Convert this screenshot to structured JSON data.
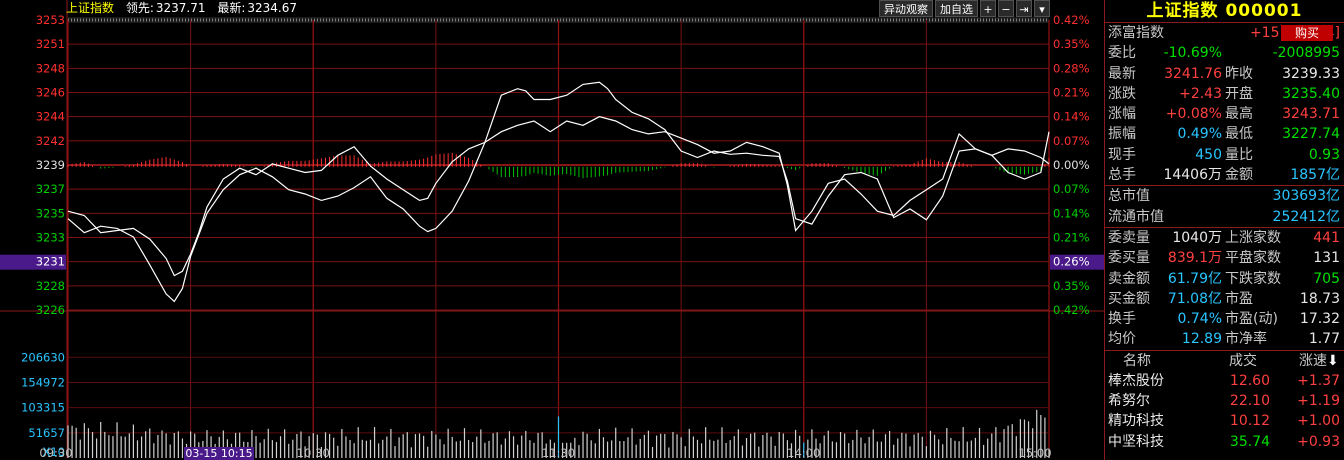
{
  "header": {
    "title": "上证指数",
    "lead_label": "领先:",
    "lead_value": "3237.71",
    "latest_label": "最新:",
    "latest_value": "3234.67"
  },
  "toolbar": {
    "watch_label": "异动观察",
    "add_label": "加自选",
    "plus_symbol": "+",
    "minus_symbol": "−",
    "next_symbol": "⇥",
    "menu_symbol": "▾"
  },
  "price_axis": {
    "left_labels": [
      "3253",
      "3251",
      "3248",
      "3246",
      "3244",
      "3242",
      "3239",
      "3237",
      "3235",
      "3233",
      "3231",
      "3228",
      "3226"
    ],
    "right_labels": [
      "0.42%",
      "0.35%",
      "0.28%",
      "0.21%",
      "0.14%",
      "0.07%",
      "0.00%",
      "0.07%",
      "0.14%",
      "0.21%",
      "0.26%",
      "0.35%",
      "0.42%"
    ],
    "highlight_label": "3231",
    "highlight_right": "0.26%"
  },
  "volume_axis": {
    "labels": [
      "206630",
      "154972",
      "103315",
      "51657"
    ],
    "unit": "X10"
  },
  "time_axis": {
    "labels": [
      "09:30",
      "10:30",
      "11:30",
      "14:00",
      "15:00"
    ],
    "cursor_label": "03-15 10:15"
  },
  "chart_data": {
    "type": "line",
    "title": "上证指数",
    "prev_close": 3239.33,
    "ylim": [
      3226,
      3253
    ],
    "x_ticks": [
      "09:30",
      "10:30",
      "11:30",
      "14:00",
      "15:00"
    ],
    "volume_ylim": [
      0,
      258288
    ],
    "series": [
      {
        "name": "最新",
        "color": "#ffffff",
        "x": [
          0,
          4,
          8,
          12,
          16,
          20,
          24,
          26,
          28,
          30,
          32,
          34,
          38,
          42,
          46,
          50,
          54,
          58,
          62,
          66,
          70,
          74,
          78,
          82,
          86,
          88,
          90,
          94,
          98,
          102,
          106,
          110,
          112,
          114,
          118,
          122,
          126,
          130,
          132,
          134,
          138,
          142,
          146,
          150,
          154,
          158,
          162,
          166,
          170,
          174,
          176,
          178,
          182,
          186,
          190,
          194,
          198,
          202,
          206,
          210,
          214,
          218,
          222,
          226,
          230,
          234,
          238,
          240
        ],
        "values": [
          3234.5,
          3233.2,
          3233.8,
          3233.6,
          3232.8,
          3230.2,
          3227.5,
          3226.8,
          3228,
          3231,
          3233,
          3235,
          3237.2,
          3238.6,
          3239.2,
          3238.4,
          3237.2,
          3236.8,
          3236.2,
          3236.6,
          3237.4,
          3238.4,
          3236.4,
          3235.4,
          3233.8,
          3233.3,
          3233.6,
          3235.2,
          3238,
          3241.6,
          3246,
          3246.6,
          3246.4,
          3245.6,
          3245.6,
          3246,
          3247,
          3247.2,
          3246.6,
          3245.6,
          3244.4,
          3243.8,
          3242.8,
          3240.8,
          3240.2,
          3240.8,
          3240.5,
          3240.6,
          3240.4,
          3240.3,
          3238,
          3234.5,
          3234,
          3236.6,
          3238.6,
          3238.8,
          3238.2,
          3234.6,
          3235.4,
          3234.4,
          3236.6,
          3240.8,
          3241,
          3240.4,
          3241,
          3240.8,
          3240.2,
          3239.6
        ]
      },
      {
        "name": "领先",
        "color": "#ffffff",
        "x": [
          0,
          4,
          8,
          12,
          16,
          20,
          24,
          26,
          28,
          30,
          32,
          34,
          38,
          42,
          46,
          50,
          54,
          58,
          62,
          66,
          70,
          74,
          78,
          82,
          86,
          88,
          90,
          94,
          98,
          102,
          106,
          110,
          114,
          118,
          122,
          126,
          130,
          134,
          138,
          142,
          146,
          150,
          154,
          158,
          162,
          166,
          170,
          174,
          176,
          178,
          182,
          186,
          190,
          194,
          198,
          202,
          206,
          210,
          214,
          218,
          222,
          226,
          230,
          234,
          238,
          240
        ],
        "values": [
          3235.2,
          3234.8,
          3233.2,
          3233.4,
          3233.6,
          3232.6,
          3230.8,
          3229.2,
          3229.6,
          3231.2,
          3233.2,
          3235.6,
          3238.2,
          3239.2,
          3238.6,
          3239.6,
          3239.2,
          3238.8,
          3239,
          3240.4,
          3241.2,
          3239.4,
          3238.2,
          3237.2,
          3236.2,
          3236.4,
          3237.8,
          3239.8,
          3241,
          3241.6,
          3242.6,
          3243.2,
          3243.6,
          3242.6,
          3243.6,
          3243.2,
          3244,
          3243.6,
          3242.8,
          3242.4,
          3242.6,
          3242,
          3241.4,
          3240.6,
          3240.8,
          3241.6,
          3241.2,
          3240.6,
          3237.6,
          3233.4,
          3235.2,
          3237.8,
          3238.2,
          3236.8,
          3235.2,
          3234.8,
          3236.2,
          3237.2,
          3238.2,
          3242.4,
          3241,
          3240.4,
          3238.8,
          3238.2,
          3238.8,
          3242.6
        ]
      }
    ]
  },
  "panel": {
    "title": "上证指数 000001",
    "rows1": [
      {
        "l1": "添富指数",
        "v1": "+15.11%[年]",
        "c1": "red"
      },
      {
        "l1": "委比",
        "v1": "-10.69%",
        "c1": "grn",
        "v2": "-2008995",
        "c2": "grn"
      },
      {
        "l1": "最新",
        "v1": "3241.76",
        "c1": "red",
        "l2": "昨收",
        "v2": "3239.33",
        "c2": "wht"
      },
      {
        "l1": "涨跌",
        "v1": "+2.43",
        "c1": "red",
        "l2": "开盘",
        "v2": "3235.40",
        "c2": "grn"
      },
      {
        "l1": "涨幅",
        "v1": "+0.08%",
        "c1": "red",
        "l2": "最高",
        "v2": "3243.71",
        "c2": "red"
      },
      {
        "l1": "振幅",
        "v1": "0.49%",
        "c1": "cyan",
        "l2": "最低",
        "v2": "3227.74",
        "c2": "grn"
      },
      {
        "l1": "现手",
        "v1": "450",
        "c1": "cyan",
        "l2": "量比",
        "v2": "0.93",
        "c2": "grn"
      },
      {
        "l1": "总手",
        "v1": "14406万",
        "c1": "wht",
        "l2": "金额",
        "v2": "1857亿",
        "c2": "cyan"
      }
    ],
    "buy_label": "购买",
    "rows2": [
      {
        "l1": "总市值",
        "v1": "303693亿",
        "c1": "cyan"
      },
      {
        "l1": "流通市值",
        "v1": "252412亿",
        "c1": "cyan"
      }
    ],
    "rows3": [
      {
        "l1": "委卖量",
        "v1": "1040万",
        "c1": "wht",
        "l2": "上涨家数",
        "v2": "441",
        "c2": "red"
      },
      {
        "l1": "委买量",
        "v1": "839.1万",
        "c1": "red",
        "l2": "平盘家数",
        "v2": "131",
        "c2": "wht"
      },
      {
        "l1": "卖金额",
        "v1": "61.79亿",
        "c1": "cyan",
        "l2": "下跌家数",
        "v2": "705",
        "c2": "grn"
      },
      {
        "l1": "买金额",
        "v1": "71.08亿",
        "c1": "cyan",
        "l2": "市盈",
        "v2": "18.73",
        "c2": "wht"
      },
      {
        "l1": "换手",
        "v1": "0.74%",
        "c1": "cyan",
        "l2": "市盈(动)",
        "v2": "17.32",
        "c2": "wht"
      },
      {
        "l1": "均价",
        "v1": "12.89",
        "c1": "cyan",
        "l2": "市净率",
        "v2": "1.77",
        "c2": "wht"
      }
    ],
    "list_header": {
      "name": "名称",
      "price": "成交",
      "speed": "涨速"
    },
    "stocks": [
      {
        "name": "棒杰股份",
        "price": "12.60",
        "speed": "+1.37",
        "pc": "red",
        "sc": "red"
      },
      {
        "name": "希努尔",
        "price": "22.10",
        "speed": "+1.19",
        "pc": "red",
        "sc": "red"
      },
      {
        "name": "精功科技",
        "price": "10.12",
        "speed": "+1.00",
        "pc": "red",
        "sc": "red"
      },
      {
        "name": "中坚科技",
        "price": "35.74",
        "speed": "+0.93",
        "pc": "grn",
        "sc": "red"
      }
    ]
  }
}
